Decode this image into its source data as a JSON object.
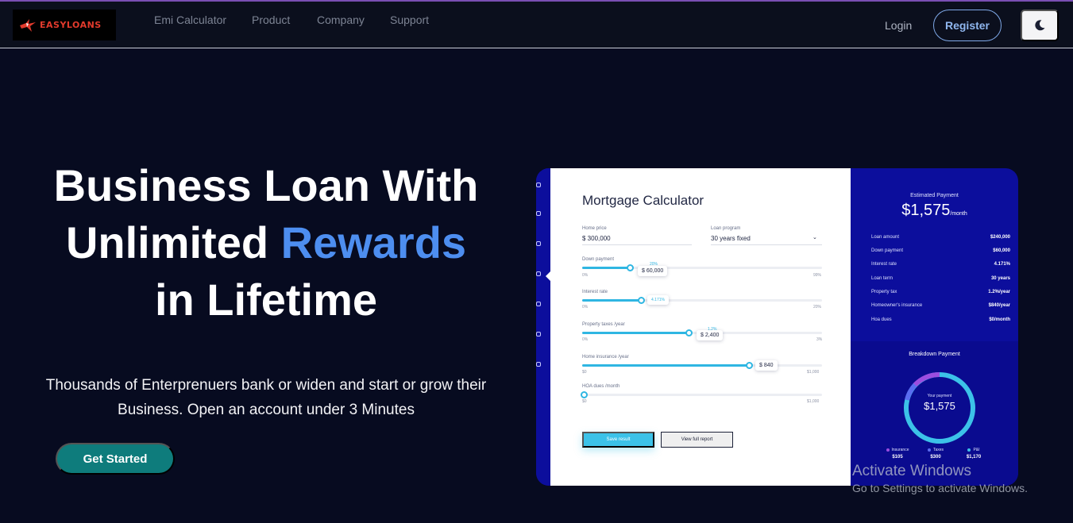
{
  "nav": {
    "brand": "EASYLOANS",
    "links": [
      "Emi Calculator",
      "Product",
      "Company",
      "Support"
    ],
    "login": "Login",
    "register": "Register"
  },
  "hero": {
    "title_line1": "Business Loan With",
    "title_line2_a": "Unlimited ",
    "title_line2_b": "Rewards",
    "title_line3": "in Lifetime",
    "subtitle": "Thousands of Enterprenuers bank or widen and start or grow their Business. Open an account under 3 Minutes",
    "cta": "Get Started"
  },
  "calculator": {
    "title": "Mortgage Calculator",
    "home_price_label": "Home price",
    "home_price_value": "$ 300,000",
    "loan_program_label": "Loan program",
    "loan_program_value": "30 years fixed",
    "sliders": [
      {
        "label": "Down payment",
        "min": "0%",
        "max": "99%",
        "tip": "$ 60,000",
        "tip_pct": "20%",
        "level": 0.2
      },
      {
        "label": "Interest rate",
        "min": "0%",
        "max": "20%",
        "tip": "4.171%",
        "tip_pct": "",
        "level": 0.21
      },
      {
        "label": "Property taxes /year",
        "min": "0%",
        "max": "3%",
        "tip": "$ 2,400",
        "tip_pct": "1.2%",
        "level": 0.4
      },
      {
        "label": "Home insurance /year",
        "min": "$0",
        "max": "$1,000",
        "tip": "$ 840",
        "tip_pct": "",
        "level": 0.84
      },
      {
        "label": "HOA dues /month",
        "min": "$0",
        "max": "$1,000",
        "tip": "",
        "tip_pct": "",
        "level": 0.0
      }
    ],
    "save_label": "Save result",
    "view_label": "View full report"
  },
  "summary": {
    "estimated_label": "Estimated Payment",
    "estimated_value": "$1,575",
    "estimated_unit": "/month",
    "rows": [
      {
        "label": "Loan amount",
        "value": "$240,000"
      },
      {
        "label": "Down payment",
        "value": "$60,000"
      },
      {
        "label": "Interest rate",
        "value": "4.171%"
      },
      {
        "label": "Loan term",
        "value": "30 years"
      },
      {
        "label": "Property tax",
        "value": "1.2%/year"
      },
      {
        "label": "Homeowner's insurance",
        "value": "$840/year"
      },
      {
        "label": "Hoa dues",
        "value": "$0/month"
      }
    ],
    "breakdown_label": "Breakdown Payment",
    "ring_sub": "Your payment",
    "ring_value": "$1,575",
    "legend": [
      {
        "name": "Insurance",
        "value": "$105",
        "color": "#9b4de0"
      },
      {
        "name": "Taxes",
        "value": "$300",
        "color": "#5a6cf0"
      },
      {
        "name": "P&I",
        "value": "$1,170",
        "color": "#3cc2e8"
      }
    ]
  },
  "watermark": {
    "line1": "Activate Windows",
    "line2": "Go to Settings to activate Windows."
  }
}
